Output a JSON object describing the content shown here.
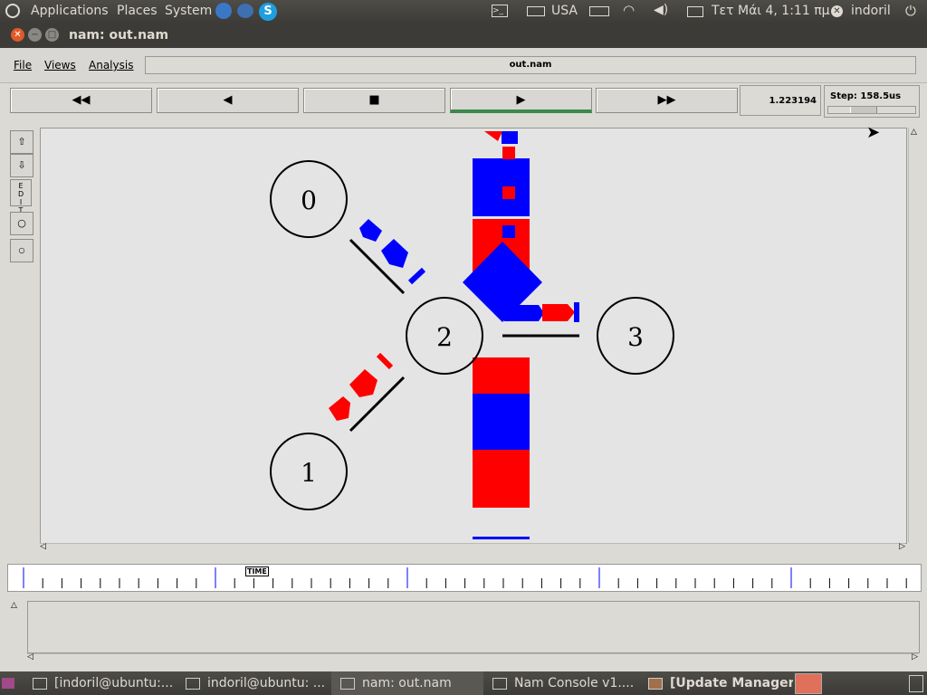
{
  "top_panel": {
    "menus": [
      "Applications",
      "Places",
      "System"
    ],
    "keyboard": "USA",
    "datetime": "Τετ Μάι  4,  1:11 πμ",
    "user": "indoril"
  },
  "window": {
    "title": "nam: out.nam"
  },
  "menubar": {
    "items": [
      "File",
      "Views",
      "Analysis"
    ],
    "filename": "out.nam"
  },
  "playback": {
    "buttons": [
      "rewind",
      "play-backward",
      "stop",
      "play",
      "fast-forward"
    ],
    "time": "1.223194",
    "step": "Step: 158.5us"
  },
  "tools": [
    "EDIT"
  ],
  "nodes": [
    {
      "id": "0"
    },
    {
      "id": "1"
    },
    {
      "id": "2"
    },
    {
      "id": "3"
    }
  ],
  "colors": {
    "red": "#ff0000",
    "blue": "#0000ff",
    "canvas": "#e4e4e4"
  },
  "timeline": {
    "label": "TIME"
  },
  "taskbar": {
    "items": [
      "[indoril@ubuntu:...",
      "indoril@ubuntu: ...",
      "nam: out.nam",
      "Nam Console v1....",
      "[Update Manager]"
    ]
  }
}
